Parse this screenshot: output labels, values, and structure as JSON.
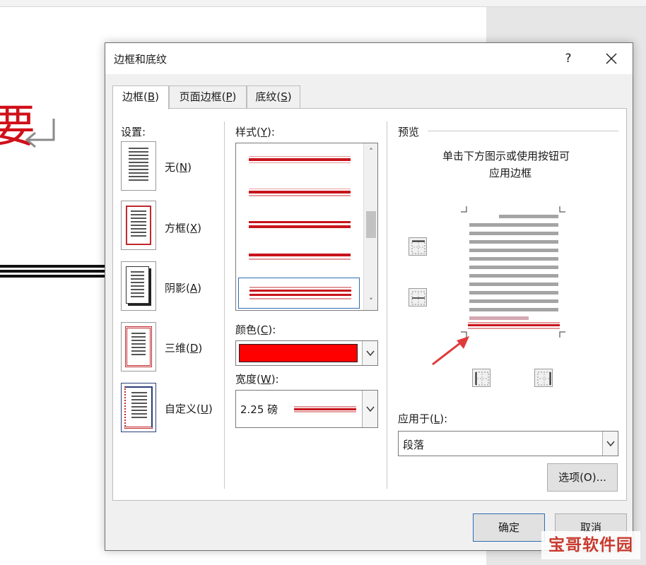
{
  "background_doc": {
    "big_char": "要"
  },
  "dialog": {
    "title": "边框和底纹",
    "help_label": "?",
    "tabs": [
      {
        "label": "边框(",
        "key": "B",
        "tail": ")"
      },
      {
        "label": "页面边框(",
        "key": "P",
        "tail": ")"
      },
      {
        "label": "底纹(",
        "key": "S",
        "tail": ")"
      }
    ],
    "settings": {
      "header": "设置:",
      "items": [
        {
          "label": "无(",
          "key": "N",
          "tail": ")"
        },
        {
          "label": "方框(",
          "key": "X",
          "tail": ")"
        },
        {
          "label": "阴影(",
          "key": "A",
          "tail": ")"
        },
        {
          "label": "三维(",
          "key": "D",
          "tail": ")"
        },
        {
          "label": "自定义(",
          "key": "U",
          "tail": ")"
        }
      ]
    },
    "style": {
      "header": "样式(",
      "key": "Y",
      "tail": "):"
    },
    "color": {
      "header": "颜色(",
      "key": "C",
      "tail": "):",
      "value": "#ff0000"
    },
    "width": {
      "header": "宽度(",
      "key": "W",
      "tail": "):",
      "value": "2.25 磅"
    },
    "preview": {
      "header": "预览",
      "hint_line1": "单击下方图示或使用按钮可",
      "hint_line2": "应用边框"
    },
    "apply_to": {
      "header": "应用于(",
      "key": "L",
      "tail": "):",
      "value": "段落"
    },
    "options_button": "选项(O)...",
    "ok_button": "确定",
    "cancel_button": "取消"
  },
  "watermark": "宝哥软件园",
  "colors": {
    "accent_red": "#d0101a",
    "border_red": "#ff0000",
    "selection_blue": "#2f6db5",
    "arrow_red": "#e03a3a"
  }
}
